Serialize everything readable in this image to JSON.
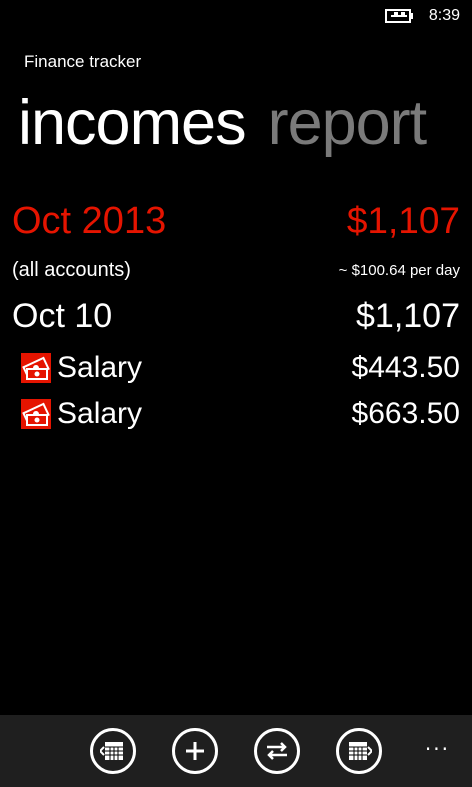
{
  "status": {
    "time": "8:39",
    "battery_icon": "battery-charging-icon"
  },
  "app": {
    "title": "Finance tracker"
  },
  "pivots": {
    "active": "incomes",
    "next": "report"
  },
  "summary": {
    "month": "Oct 2013",
    "month_total": "$1,107",
    "scope": "(all accounts)",
    "per_day": "~ $100.64 per day"
  },
  "day_group": {
    "date": "Oct 10",
    "total": "$1,107"
  },
  "items": [
    {
      "category": "Salary",
      "amount": "$443.50",
      "icon": "money-category-icon"
    },
    {
      "category": "Salary",
      "amount": "$663.50",
      "icon": "money-category-icon"
    }
  ],
  "appbar": {
    "buttons": [
      {
        "icon": "previous-month-calendar-icon"
      },
      {
        "icon": "add-icon"
      },
      {
        "icon": "transfer-icon"
      },
      {
        "icon": "next-month-calendar-icon"
      }
    ],
    "more_label": "..."
  },
  "colors": {
    "accent": "#e51400",
    "background": "#000000",
    "appbar": "#1f1f1f"
  }
}
